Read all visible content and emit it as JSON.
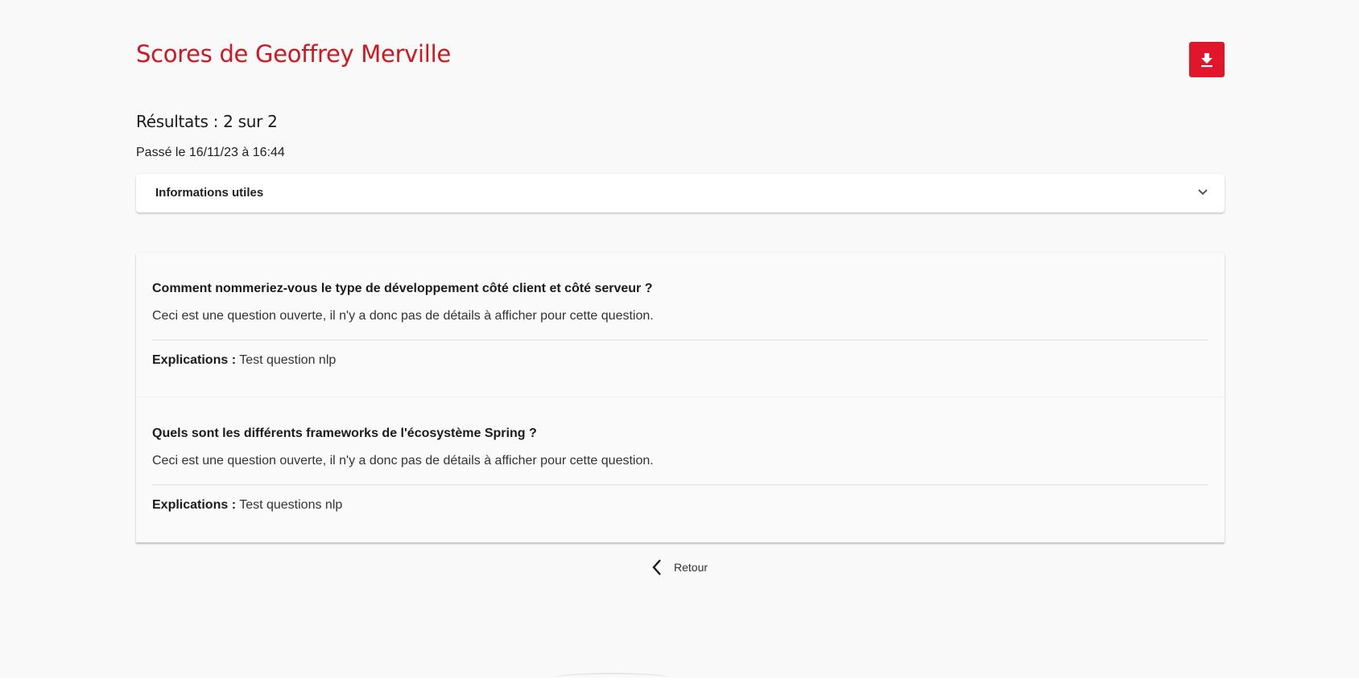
{
  "header": {
    "title": "Scores de Geoffrey Merville",
    "download_icon": "download-icon"
  },
  "summary": {
    "results": "Résultats : 2 sur 2",
    "passed": "Passé le 16/11/23 à 16:44"
  },
  "info_panel": {
    "label": "Informations utiles",
    "icon": "chevron-down-icon"
  },
  "questions": [
    {
      "title": "Comment nommeriez-vous le type de développement côté client et côté serveur ?",
      "detail": "Ceci est une question ouverte, il n'y a donc pas de détails à afficher pour cette question.",
      "explanation_label": "Explications :",
      "explanation": " Test question nlp"
    },
    {
      "title": "Quels sont les différents frameworks de l'écosystème Spring ?",
      "detail": "Ceci est une question ouverte, il n'y a donc pas de détails à afficher pour cette question.",
      "explanation_label": "Explications :",
      "explanation": " Test questions nlp"
    }
  ],
  "footer": {
    "back_label": "Retour",
    "back_icon": "chevron-left-icon"
  },
  "colors": {
    "accent": "#d0161f",
    "button": "#e0162b",
    "background": "#f9f9f9"
  }
}
